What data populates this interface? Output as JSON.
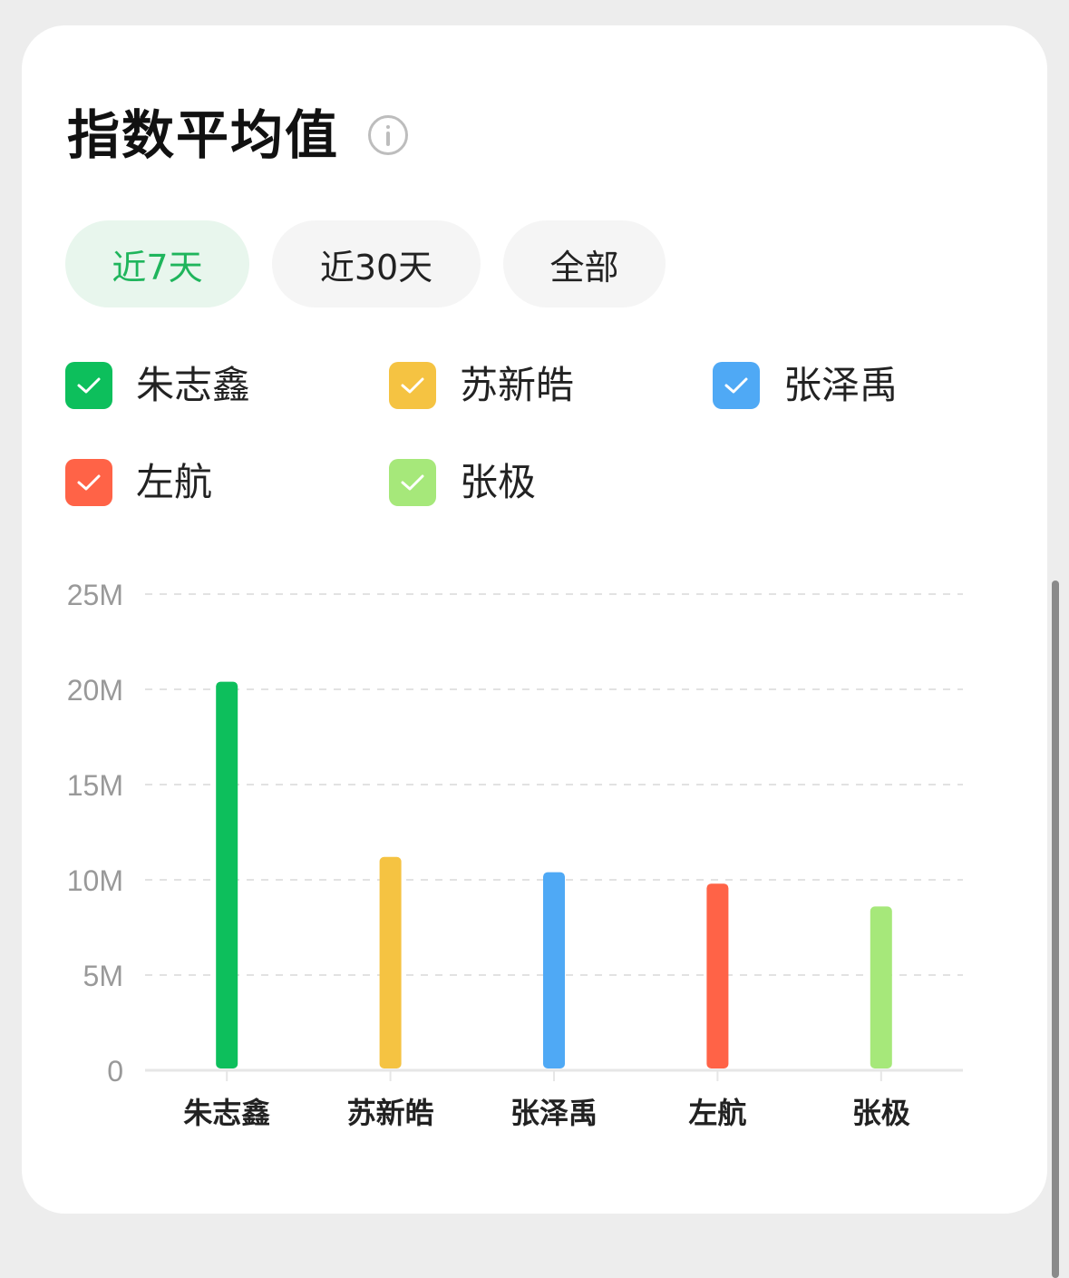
{
  "title": "指数平均值",
  "range_tabs": [
    {
      "label": "近7天",
      "active": true
    },
    {
      "label": "近30天",
      "active": false
    },
    {
      "label": "全部",
      "active": false
    }
  ],
  "legend": [
    {
      "label": "朱志鑫",
      "color": "#0dbf5c",
      "checked": true
    },
    {
      "label": "苏新皓",
      "color": "#f5c342",
      "checked": true
    },
    {
      "label": "张泽禹",
      "color": "#4fa9f5",
      "checked": true
    },
    {
      "label": "左航",
      "color": "#ff6347",
      "checked": true
    },
    {
      "label": "张极",
      "color": "#a6e87a",
      "checked": true
    }
  ],
  "chart_data": {
    "type": "bar",
    "categories": [
      "朱志鑫",
      "苏新皓",
      "张泽禹",
      "左航",
      "张极"
    ],
    "values": [
      20.4,
      11.2,
      10.4,
      9.8,
      8.6
    ],
    "unit": "M",
    "colors": [
      "#0dbf5c",
      "#f5c342",
      "#4fa9f5",
      "#ff6347",
      "#a6e87a"
    ],
    "ylim": [
      0,
      25
    ],
    "yticks": [
      0,
      5,
      10,
      15,
      20,
      25
    ],
    "ytick_labels": [
      "0",
      "5M",
      "10M",
      "15M",
      "20M",
      "25M"
    ],
    "grid": true,
    "legend_position": "top"
  }
}
